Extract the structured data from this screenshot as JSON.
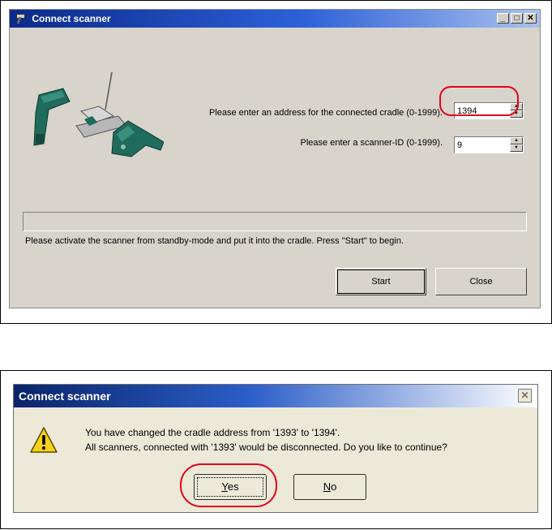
{
  "window1": {
    "title": "Connect scanner",
    "controls": {
      "minimize": "_",
      "maximize": "□",
      "close": "✕"
    },
    "address_label": "Please enter an address for the connected cradle  (0-1999).",
    "address_value": "1394",
    "scanner_id_label": "Please enter a  scanner-ID (0-1999).",
    "scanner_id_value": "9",
    "status_text": "Please activate the scanner from standby-mode and put it into the cradle. Press \"Start\" to begin.",
    "start_label": "Start",
    "close_label": "Close",
    "highlight_color": "#e3001b"
  },
  "dialog2": {
    "title": "Connect scanner",
    "close_glyph": "✕",
    "message_line1": "You have changed the cradle address from '1393' to '1394'.",
    "message_line2": "All scanners, connected with '1393' would be disconnected. Do you like to continue?",
    "yes_label_mnemonic": "Y",
    "yes_label_rest": "es",
    "no_label_mnemonic": "N",
    "no_label_rest": "o",
    "icon": "warning-icon"
  }
}
